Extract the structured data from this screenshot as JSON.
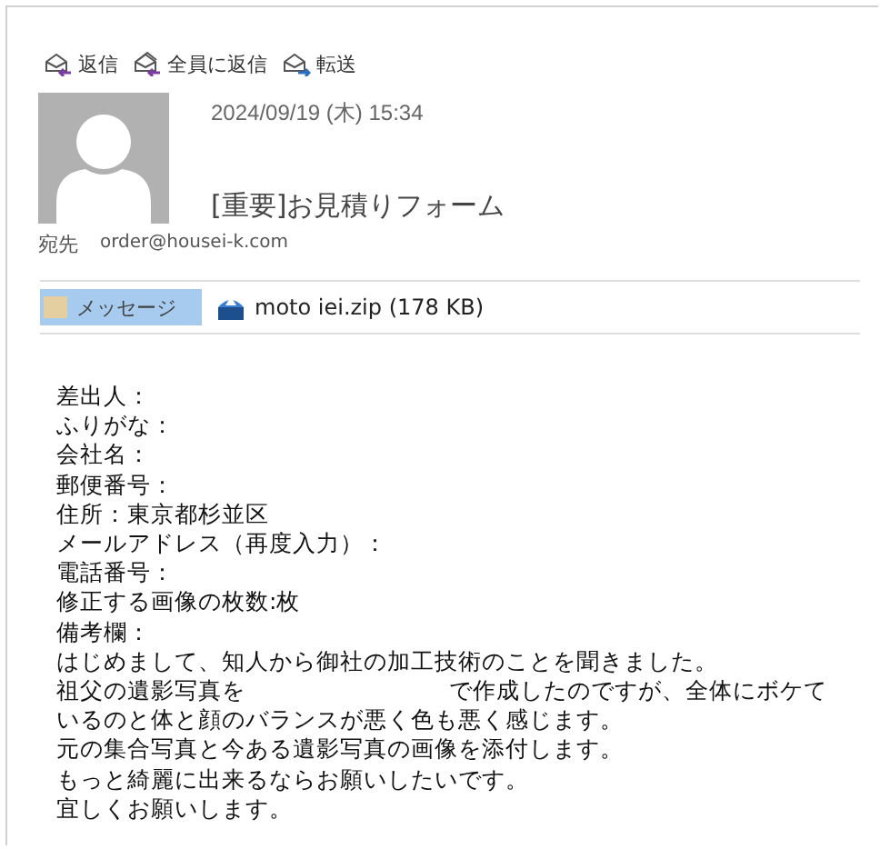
{
  "toolbar": [
    {
      "label": "返信",
      "kind": "reply"
    },
    {
      "label": "全員に返信",
      "kind": "reply-all"
    },
    {
      "label": "転送",
      "kind": "forward"
    }
  ],
  "message": {
    "date": "2024/09/19 (木) 15:34",
    "subject": "[重要]お見積りフォーム",
    "to_label": "宛先",
    "to": "order@housei-k.com"
  },
  "attachments": [
    {
      "label": "メッセージ",
      "kind": "message",
      "selected": true
    },
    {
      "label": "moto iei.zip (178 KB)",
      "kind": "zip",
      "selected": false
    }
  ],
  "body": [
    [
      "差出人："
    ],
    [
      "ふりがな："
    ],
    [
      "会社名："
    ],
    [
      "郵便番号："
    ],
    [
      "住所：東京都杉並区"
    ],
    [
      "メールアドレス（再度入力）："
    ],
    [
      "電話番号："
    ],
    [
      "修正する画像の枚数:枚"
    ],
    [
      "備考欄："
    ],
    [
      "はじめまして、知人から御社の加工技術のことを聞きました。"
    ],
    [
      "祖父の遺影写真を",
      "で作成したのですが、全体にボケて"
    ],
    [
      "いるのと体と顔のバランスが悪く色も悪く感じます。"
    ],
    [
      "元の集合写真と今ある遺影写真の画像を添付します。"
    ],
    [
      "もっと綺麗に出来るならお願いしたいです。"
    ],
    [
      "宜しくお願いします。"
    ]
  ]
}
